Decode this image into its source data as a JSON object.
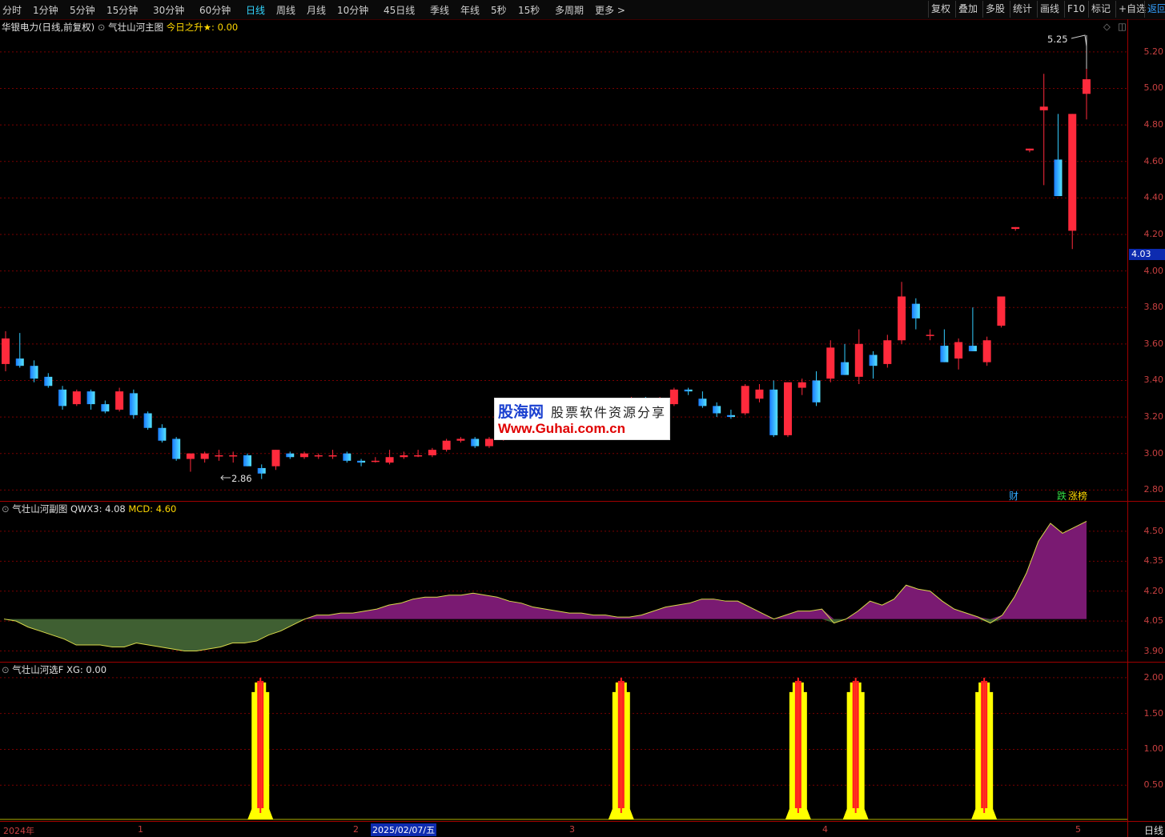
{
  "toolbar": {
    "periods": [
      "分时",
      "1分钟",
      "5分钟",
      "15分钟",
      "30分钟",
      "60分钟",
      "日线",
      "周线",
      "月线",
      "10分钟",
      "45日线",
      "季线",
      "年线",
      "5秒",
      "15秒",
      "多周期",
      "更多 >"
    ],
    "active_period": "日线",
    "right_buttons": [
      "复权",
      "叠加",
      "多股",
      "统计",
      "画线",
      "F10",
      "标记",
      "+自选",
      "返回"
    ]
  },
  "main_panel": {
    "stock_name": "华银电力",
    "mode": "(日线,前复权)",
    "indicator_name": "气壮山河主图",
    "indicator_value_label": "今日之升★:",
    "indicator_value": "0.00",
    "high_marker": "5.25",
    "low_marker": "2.86",
    "current_price": "4.03",
    "price_ticks": [
      "5.20",
      "5.00",
      "4.80",
      "4.60",
      "4.40",
      "4.20",
      "4.00",
      "3.80",
      "3.60",
      "3.40",
      "3.20",
      "3.00",
      "2.80"
    ],
    "badges": [
      "财",
      "跌",
      "涨榜"
    ]
  },
  "sub_panel": {
    "indicator_name": "气壮山河副图",
    "line1_label": "QWX3:",
    "line1_value": "4.08",
    "line2_label": "MCD:",
    "line2_value": "4.60",
    "ticks": [
      "4.50",
      "4.35",
      "4.20",
      "4.05",
      "3.90"
    ]
  },
  "select_panel": {
    "indicator_name": "气壮山河选F",
    "line_label": "XG:",
    "line_value": "0.00",
    "ticks": [
      "2.00",
      "1.50",
      "1.00",
      "0.50"
    ]
  },
  "date_axis": {
    "year_label": "2024年",
    "month_labels": [
      "1",
      "2",
      "3",
      "4",
      "5"
    ],
    "cursor_date": "2025/02/07/五",
    "period_label": "日线"
  },
  "watermark": {
    "logo": "股海网",
    "tagline": "股票软件资源分享",
    "url": "Www.Guhai.com.cn"
  },
  "colors": {
    "up": "#ff2a3c",
    "down": "#33ccff",
    "grid": "#7a0000",
    "axis_text": "#c84040",
    "positive_area": "#7a1a72",
    "negative_area": "#3f5f32",
    "signal_yellow": "#ffff00",
    "signal_red": "#ff2020"
  },
  "main_chart_data": {
    "type": "candlestick",
    "price_range": [
      2.74,
      5.3
    ],
    "candles": [
      {
        "o": 3.49,
        "h": 3.67,
        "l": 3.45,
        "c": 3.63
      },
      {
        "o": 3.52,
        "h": 3.66,
        "l": 3.47,
        "c": 3.48
      },
      {
        "o": 3.48,
        "h": 3.51,
        "l": 3.39,
        "c": 3.41
      },
      {
        "o": 3.42,
        "h": 3.44,
        "l": 3.36,
        "c": 3.37
      },
      {
        "o": 3.35,
        "h": 3.37,
        "l": 3.24,
        "c": 3.26
      },
      {
        "o": 3.27,
        "h": 3.35,
        "l": 3.26,
        "c": 3.34
      },
      {
        "o": 3.34,
        "h": 3.35,
        "l": 3.24,
        "c": 3.27
      },
      {
        "o": 3.27,
        "h": 3.29,
        "l": 3.22,
        "c": 3.23
      },
      {
        "o": 3.24,
        "h": 3.36,
        "l": 3.23,
        "c": 3.34
      },
      {
        "o": 3.33,
        "h": 3.35,
        "l": 3.19,
        "c": 3.21
      },
      {
        "o": 3.22,
        "h": 3.23,
        "l": 3.13,
        "c": 3.14
      },
      {
        "o": 3.14,
        "h": 3.16,
        "l": 3.06,
        "c": 3.07
      },
      {
        "o": 3.08,
        "h": 3.09,
        "l": 2.96,
        "c": 2.97
      },
      {
        "o": 2.97,
        "h": 3.0,
        "l": 2.9,
        "c": 3.0
      },
      {
        "o": 2.97,
        "h": 3.01,
        "l": 2.95,
        "c": 3.0
      },
      {
        "o": 2.99,
        "h": 3.02,
        "l": 2.96,
        "c": 2.99
      },
      {
        "o": 2.99,
        "h": 3.01,
        "l": 2.95,
        "c": 2.99
      },
      {
        "o": 2.99,
        "h": 3.0,
        "l": 2.93,
        "c": 2.93
      },
      {
        "o": 2.92,
        "h": 2.94,
        "l": 2.86,
        "c": 2.89
      },
      {
        "o": 2.93,
        "h": 3.02,
        "l": 2.91,
        "c": 3.02
      },
      {
        "o": 3.0,
        "h": 3.01,
        "l": 2.97,
        "c": 2.98
      },
      {
        "o": 2.98,
        "h": 3.01,
        "l": 2.97,
        "c": 3.0
      },
      {
        "o": 2.99,
        "h": 3.0,
        "l": 2.97,
        "c": 2.99
      },
      {
        "o": 2.99,
        "h": 3.02,
        "l": 2.97,
        "c": 2.99
      },
      {
        "o": 3.0,
        "h": 3.01,
        "l": 2.95,
        "c": 2.96
      },
      {
        "o": 2.96,
        "h": 2.97,
        "l": 2.93,
        "c": 2.95
      },
      {
        "o": 2.96,
        "h": 2.98,
        "l": 2.95,
        "c": 2.96
      },
      {
        "o": 2.95,
        "h": 3.02,
        "l": 2.94,
        "c": 2.98
      },
      {
        "o": 2.98,
        "h": 3.01,
        "l": 2.97,
        "c": 2.99
      },
      {
        "o": 2.99,
        "h": 3.02,
        "l": 2.98,
        "c": 2.99
      },
      {
        "o": 2.99,
        "h": 3.03,
        "l": 2.98,
        "c": 3.02
      },
      {
        "o": 3.02,
        "h": 3.08,
        "l": 3.01,
        "c": 3.07
      },
      {
        "o": 3.07,
        "h": 3.09,
        "l": 3.06,
        "c": 3.08
      },
      {
        "o": 3.08,
        "h": 3.09,
        "l": 3.03,
        "c": 3.04
      },
      {
        "o": 3.04,
        "h": 3.09,
        "l": 3.03,
        "c": 3.08
      },
      {
        "o": 3.08,
        "h": 3.1,
        "l": 3.07,
        "c": 3.09
      },
      {
        "o": 3.09,
        "h": 3.16,
        "l": 3.08,
        "c": 3.15
      },
      {
        "o": 3.15,
        "h": 3.21,
        "l": 3.13,
        "c": 3.2
      },
      {
        "o": 3.2,
        "h": 3.22,
        "l": 3.13,
        "c": 3.15
      },
      {
        "o": 3.13,
        "h": 3.14,
        "l": 3.1,
        "c": 3.12
      },
      {
        "o": 3.11,
        "h": 3.13,
        "l": 3.09,
        "c": 3.11
      },
      {
        "o": 3.18,
        "h": 3.21,
        "l": 3.15,
        "c": 3.18
      },
      {
        "o": 3.19,
        "h": 3.23,
        "l": 3.16,
        "c": 3.2
      },
      {
        "o": 3.2,
        "h": 3.29,
        "l": 3.19,
        "c": 3.28
      },
      {
        "o": 3.29,
        "h": 3.31,
        "l": 3.27,
        "c": 3.3
      },
      {
        "o": 3.3,
        "h": 3.31,
        "l": 3.28,
        "c": 3.29
      },
      {
        "o": 3.29,
        "h": 3.31,
        "l": 3.25,
        "c": 3.29
      },
      {
        "o": 3.27,
        "h": 3.36,
        "l": 3.26,
        "c": 3.35
      },
      {
        "o": 3.35,
        "h": 3.36,
        "l": 3.32,
        "c": 3.34
      },
      {
        "o": 3.3,
        "h": 3.34,
        "l": 3.25,
        "c": 3.26
      },
      {
        "o": 3.26,
        "h": 3.28,
        "l": 3.2,
        "c": 3.22
      },
      {
        "o": 3.21,
        "h": 3.24,
        "l": 3.19,
        "c": 3.2
      },
      {
        "o": 3.22,
        "h": 3.38,
        "l": 3.21,
        "c": 3.37
      },
      {
        "o": 3.3,
        "h": 3.38,
        "l": 3.28,
        "c": 3.35
      },
      {
        "o": 3.35,
        "h": 3.4,
        "l": 3.09,
        "c": 3.1
      },
      {
        "o": 3.1,
        "h": 3.39,
        "l": 3.09,
        "c": 3.39
      },
      {
        "o": 3.36,
        "h": 3.41,
        "l": 3.32,
        "c": 3.39
      },
      {
        "o": 3.4,
        "h": 3.45,
        "l": 3.26,
        "c": 3.28
      },
      {
        "o": 3.41,
        "h": 3.62,
        "l": 3.39,
        "c": 3.58
      },
      {
        "o": 3.5,
        "h": 3.6,
        "l": 3.43,
        "c": 3.43
      },
      {
        "o": 3.42,
        "h": 3.68,
        "l": 3.38,
        "c": 3.6
      },
      {
        "o": 3.54,
        "h": 3.56,
        "l": 3.41,
        "c": 3.48
      },
      {
        "o": 3.49,
        "h": 3.65,
        "l": 3.47,
        "c": 3.62
      },
      {
        "o": 3.62,
        "h": 3.94,
        "l": 3.6,
        "c": 3.86
      },
      {
        "o": 3.82,
        "h": 3.85,
        "l": 3.68,
        "c": 3.74
      },
      {
        "o": 3.65,
        "h": 3.68,
        "l": 3.62,
        "c": 3.65
      },
      {
        "o": 3.59,
        "h": 3.68,
        "l": 3.5,
        "c": 3.5
      },
      {
        "o": 3.52,
        "h": 3.63,
        "l": 3.46,
        "c": 3.61
      },
      {
        "o": 3.59,
        "h": 3.8,
        "l": 3.56,
        "c": 3.56
      },
      {
        "o": 3.5,
        "h": 3.64,
        "l": 3.48,
        "c": 3.62
      },
      {
        "o": 3.7,
        "h": 3.86,
        "l": 3.69,
        "c": 3.86
      },
      {
        "o": 4.23,
        "h": 4.24,
        "l": 4.22,
        "c": 4.24
      },
      {
        "o": 4.66,
        "h": 4.67,
        "l": 4.65,
        "c": 4.67
      },
      {
        "o": 4.88,
        "h": 5.08,
        "l": 4.47,
        "c": 4.9
      },
      {
        "o": 4.61,
        "h": 4.86,
        "l": 4.41,
        "c": 4.41
      },
      {
        "o": 4.22,
        "h": 4.86,
        "l": 4.12,
        "c": 4.86
      },
      {
        "o": 4.97,
        "h": 5.25,
        "l": 4.83,
        "c": 5.05
      }
    ]
  },
  "sub_chart_data": {
    "type": "area",
    "baseline": 4.06,
    "range": [
      3.87,
      4.62
    ],
    "values": [
      4.06,
      4.05,
      4.02,
      4.0,
      3.98,
      3.96,
      3.93,
      3.93,
      3.93,
      3.92,
      3.92,
      3.94,
      3.93,
      3.92,
      3.91,
      3.9,
      3.9,
      3.91,
      3.92,
      3.94,
      3.94,
      3.95,
      3.98,
      4.0,
      4.03,
      4.06,
      4.08,
      4.08,
      4.09,
      4.09,
      4.1,
      4.11,
      4.13,
      4.14,
      4.16,
      4.17,
      4.17,
      4.18,
      4.18,
      4.19,
      4.18,
      4.17,
      4.15,
      4.14,
      4.12,
      4.11,
      4.1,
      4.09,
      4.09,
      4.08,
      4.08,
      4.07,
      4.07,
      4.08,
      4.1,
      4.12,
      4.13,
      4.14,
      4.16,
      4.16,
      4.15,
      4.15,
      4.12,
      4.09,
      4.06,
      4.08,
      4.1,
      4.1,
      4.11,
      4.04,
      4.06,
      4.1,
      4.15,
      4.13,
      4.16,
      4.23,
      4.21,
      4.2,
      4.15,
      4.11,
      4.09,
      4.07,
      4.04,
      4.08,
      4.17,
      4.29,
      4.45,
      4.54,
      4.49,
      4.52,
      4.55
    ]
  },
  "select_chart_data": {
    "type": "signal",
    "range": [
      0,
      2.2
    ],
    "signal_value": 2.0,
    "signal_positions": [
      0.231,
      0.551,
      0.708,
      0.759,
      0.873
    ]
  }
}
